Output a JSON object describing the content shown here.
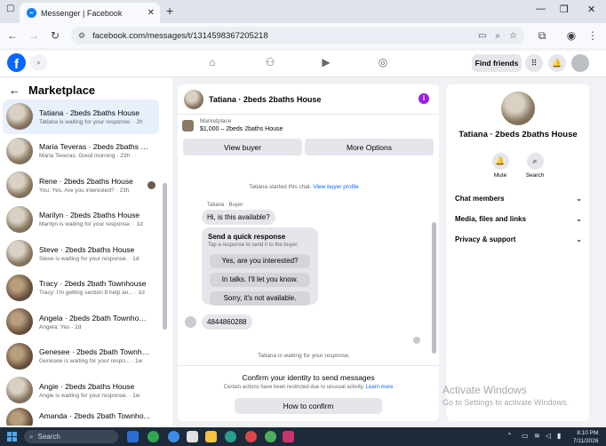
{
  "browser": {
    "tab_title": "Messenger | Facebook",
    "url": "facebook.com/messages/t/1314598367205218",
    "new_tab": "+",
    "close_tab": "✕"
  },
  "header": {
    "find_friends": "Find friends"
  },
  "left": {
    "title": "Marketplace",
    "conversations": [
      {
        "name": "Tatiana · 2beds 2baths House",
        "preview": "Tatiana is waiting for your response. · 2h"
      },
      {
        "name": "Maria Teveras · 2beds 2baths H...",
        "preview": "Maria Teveras: Good morning · 23h"
      },
      {
        "name": "Rene · 2beds 2baths House",
        "preview": "You: Yes. Are you interested? · 23h"
      },
      {
        "name": "Marilyn · 2beds 2baths House",
        "preview": "Marilyn is waiting for your response. · 1d"
      },
      {
        "name": "Steve · 2beds 2baths House",
        "preview": "Steve is waiting for your response. · 1d"
      },
      {
        "name": "Tracy · 2beds 2bath Townhouse",
        "preview": "Tracy: I'm getting section 8 help an... · 1d"
      },
      {
        "name": "Angela · 2beds 2bath Townhouse",
        "preview": "Angela: Yes · 2d"
      },
      {
        "name": "Genesee · 2beds 2bath Townho...",
        "preview": "Genesee is waiting for your respo... · 1w"
      },
      {
        "name": "Angie · 2beds 2baths House",
        "preview": "Angie is waiting for your response. · 1w"
      },
      {
        "name": "Amanda · 2beds 2bath Townho...",
        "preview": ""
      }
    ]
  },
  "chat": {
    "title": "Tatiana · 2beds 2baths House",
    "listing_label": "Marketplace",
    "listing_detail": "$1,000 – 2beds 2baths House",
    "view_buyer": "View buyer",
    "more_options": "More Options",
    "started_text": "Tatiana started this chat.",
    "started_link": "View buyer profile",
    "sender_label": "Tatiana · Buyer",
    "message1": "Hi, is this available?",
    "quick_title": "Send a quick response",
    "quick_sub": "Tap a response to send it to the buyer.",
    "quick_options": [
      "Yes, are you interested?",
      "In talks. I'll let you know.",
      "Sorry, it's not available."
    ],
    "message2": "4844860288",
    "waiting": "Tatiana is waiting for your response.",
    "confirm_title": "Confirm your identity to send messages",
    "confirm_sub": "Certain actions have been restricted due to unusual activity.",
    "learn_more": "Learn more",
    "confirm_button": "How to confirm"
  },
  "right": {
    "name": "Tatiana · 2beds 2baths House",
    "mute": "Mute",
    "search": "Search",
    "rows": [
      "Chat members",
      "Media, files and links",
      "Privacy & support"
    ]
  },
  "watermark": {
    "line1": "Activate Windows",
    "line2": "Go to Settings to activate Windows."
  },
  "taskbar": {
    "search": "Search",
    "time": "8:10 PM",
    "date": "7/11/2026"
  }
}
